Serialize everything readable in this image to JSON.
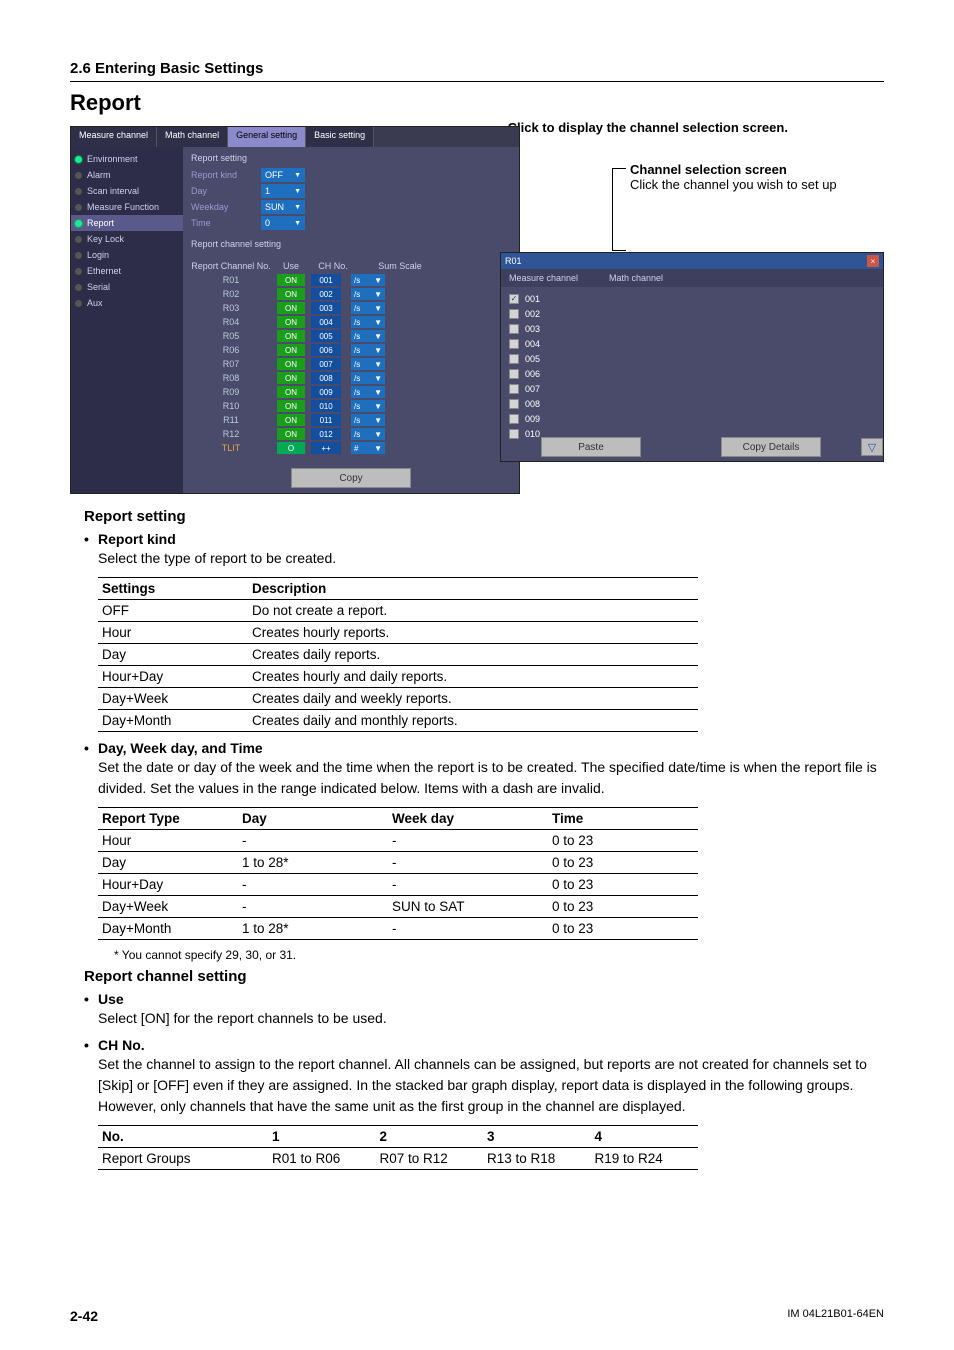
{
  "section_header": "2.6  Entering Basic Settings",
  "report_title": "Report",
  "annotations": {
    "click_display": "Click to display the channel selection screen.",
    "chan_sel_bold": "Channel selection screen",
    "chan_sel_sub": "Click the channel you wish to set up"
  },
  "main_window": {
    "tabs": [
      {
        "label": "Measure channel",
        "active": false
      },
      {
        "label": "Math channel",
        "active": false
      },
      {
        "label": "General setting",
        "active": true
      },
      {
        "label": "Basic setting",
        "active": false
      }
    ],
    "nav": [
      {
        "label": "Environment",
        "on": true
      },
      {
        "label": "Alarm",
        "on": false
      },
      {
        "label": "Scan interval",
        "on": false
      },
      {
        "label": "Measure Function",
        "on": false
      },
      {
        "label": "Report",
        "on": true,
        "sel": true
      },
      {
        "label": "Key Lock",
        "on": false
      },
      {
        "label": "Login",
        "on": false
      },
      {
        "label": "Ethernet",
        "on": false
      },
      {
        "label": "Serial",
        "on": false
      },
      {
        "label": "Aux",
        "on": false
      }
    ],
    "group1": "Report setting",
    "fields": [
      {
        "label": "Report kind",
        "value": "OFF"
      },
      {
        "label": "Day",
        "value": "1"
      },
      {
        "label": "Weekday",
        "value": "SUN"
      },
      {
        "label": "Time",
        "value": "0"
      }
    ],
    "group2": "Report channel setting",
    "theaders": [
      "Report Channel No.",
      "Use",
      "CH No.",
      "Sum Scale"
    ],
    "rows": [
      {
        "r": "R01",
        "on": "ON",
        "ch": "001",
        "sum": "/s"
      },
      {
        "r": "R02",
        "on": "ON",
        "ch": "002",
        "sum": "/s"
      },
      {
        "r": "R03",
        "on": "ON",
        "ch": "003",
        "sum": "/s"
      },
      {
        "r": "R04",
        "on": "ON",
        "ch": "004",
        "sum": "/s"
      },
      {
        "r": "R05",
        "on": "ON",
        "ch": "005",
        "sum": "/s"
      },
      {
        "r": "R06",
        "on": "ON",
        "ch": "006",
        "sum": "/s"
      },
      {
        "r": "R07",
        "on": "ON",
        "ch": "007",
        "sum": "/s"
      },
      {
        "r": "R08",
        "on": "ON",
        "ch": "008",
        "sum": "/s"
      },
      {
        "r": "R09",
        "on": "ON",
        "ch": "009",
        "sum": "/s"
      },
      {
        "r": "R10",
        "on": "ON",
        "ch": "010",
        "sum": "/s"
      },
      {
        "r": "R11",
        "on": "ON",
        "ch": "011",
        "sum": "/s"
      },
      {
        "r": "R12",
        "on": "ON",
        "ch": "012",
        "sum": "/s"
      }
    ],
    "tlit": {
      "r": "TLIT",
      "on": "O",
      "ch": "++",
      "sum": "#"
    },
    "copy_btn": "Copy"
  },
  "sel_window": {
    "title": "R01",
    "hdr": [
      "Measure channel",
      "Math channel"
    ],
    "items": [
      {
        "id": "001",
        "checked": true
      },
      {
        "id": "002"
      },
      {
        "id": "003"
      },
      {
        "id": "004"
      },
      {
        "id": "005"
      },
      {
        "id": "006"
      },
      {
        "id": "007"
      },
      {
        "id": "008"
      },
      {
        "id": "009"
      },
      {
        "id": "010"
      }
    ],
    "paste_btn": "Paste",
    "copyd_btn": "Copy Details"
  },
  "report_setting": {
    "heading": "Report setting",
    "kind_head": "Report kind",
    "kind_desc": "Select the type of report to be created.",
    "kind_table": {
      "headers": [
        "Settings",
        "Description"
      ],
      "rows": [
        [
          "OFF",
          "Do not create a report."
        ],
        [
          "Hour",
          "Creates hourly reports."
        ],
        [
          "Day",
          "Creates daily reports."
        ],
        [
          "Hour+Day",
          "Creates hourly and daily reports."
        ],
        [
          "Day+Week",
          "Creates daily and weekly reports."
        ],
        [
          "Day+Month",
          "Creates daily and monthly reports."
        ]
      ]
    },
    "dwt_head": "Day, Week day, and Time",
    "dwt_desc": "Set the date or day of the week and the time when the report is to be created.  The specified date/time is when the report file is divided.  Set the values in the range indicated below.  Items with a dash are invalid.",
    "dwt_table": {
      "headers": [
        "Report Type",
        "Day",
        "Week day",
        "Time"
      ],
      "rows": [
        [
          "Hour",
          "-",
          "-",
          "0 to 23"
        ],
        [
          "Day",
          "1 to 28*",
          "-",
          "0 to 23"
        ],
        [
          "Hour+Day",
          "-",
          "-",
          "0 to 23"
        ],
        [
          "Day+Week",
          "-",
          "SUN to SAT",
          "0 to 23"
        ],
        [
          "Day+Month",
          "1 to 28*",
          "-",
          "0 to 23"
        ]
      ]
    },
    "dwt_foot": "*   You cannot specify 29, 30, or 31."
  },
  "report_channel": {
    "heading": "Report channel setting",
    "use_head": "Use",
    "use_desc": "Select [ON] for the report channels to be used.",
    "chno_head": "CH No.",
    "chno_desc": "Set the channel to assign to the report channel.  All channels can be assigned, but reports are not created for channels set to [Skip] or [OFF] even if they are assigned.  In the stacked bar graph display, report data is displayed in the following groups.  However, only channels that have the same unit as the first group in the channel are displayed.",
    "grp_table": {
      "headers": [
        "No.",
        "1",
        "2",
        "3",
        "4"
      ],
      "rows": [
        [
          "Report Groups",
          "R01 to R06",
          "R07 to R12",
          "R13 to R18",
          "R19 to R24"
        ]
      ]
    }
  },
  "footer": {
    "page": "2-42",
    "doc": "IM 04L21B01-64EN"
  }
}
